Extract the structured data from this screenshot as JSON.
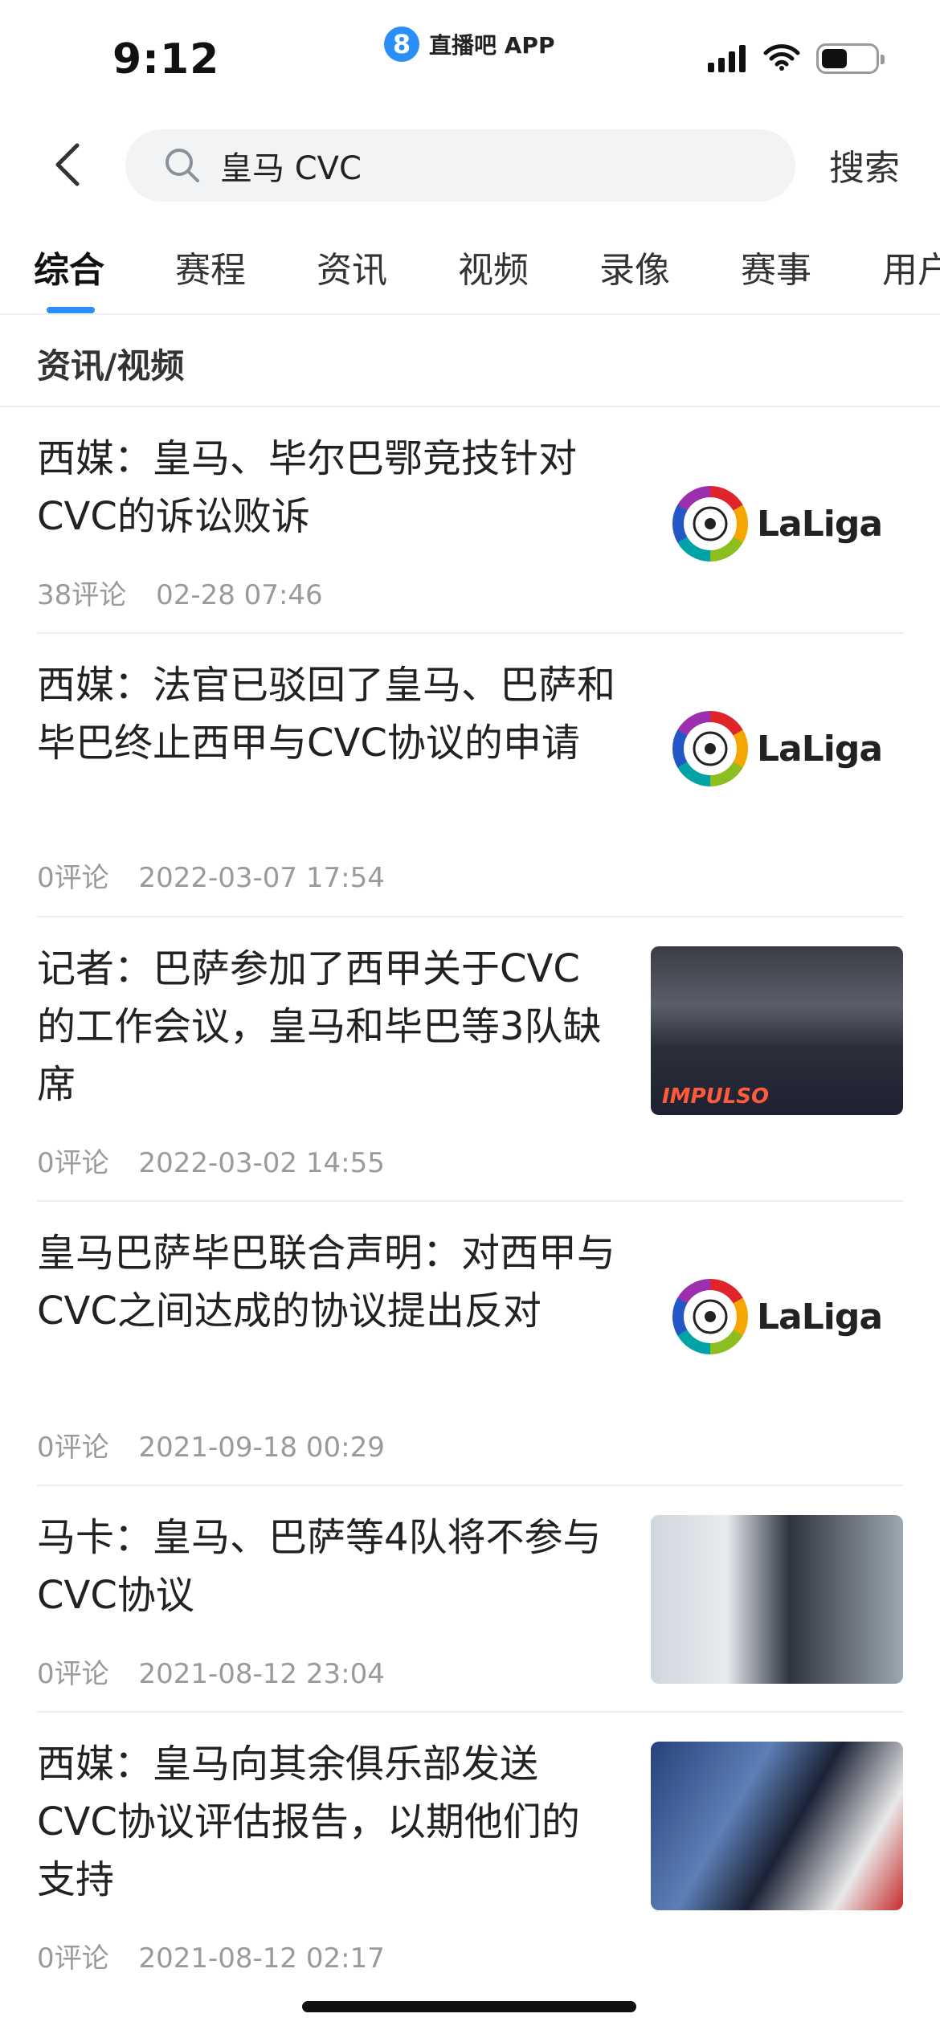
{
  "status_bar": {
    "time": "9:12",
    "app_logo_glyph": "8",
    "app_name": "直播吧 APP"
  },
  "header": {
    "search_query": "皇马 CVC",
    "search_button": "搜索"
  },
  "tabs": [
    "综合",
    "赛程",
    "资讯",
    "视频",
    "录像",
    "赛事",
    "用户"
  ],
  "active_tab": "综合",
  "section": {
    "title": "资讯/视频"
  },
  "news": [
    {
      "title": "西媒：皇马、毕尔巴鄂竞技针对CVC的诉讼败诉",
      "comments": "38评论",
      "date": "02-28 07:46",
      "thumb": "laliga-logo",
      "thumb_text": "LaLiga"
    },
    {
      "title": "西媒：法官已驳回了皇马、巴萨和毕巴终止西甲与CVC协议的申请",
      "comments": "0评论",
      "date": "2022-03-07 17:54",
      "thumb": "laliga-logo",
      "thumb_text": "LaLiga"
    },
    {
      "title": "记者：巴萨参加了西甲关于CVC的工作会议，皇马和毕巴等3队缺席",
      "comments": "0评论",
      "date": "2022-03-02 14:55",
      "thumb": "team-photo",
      "thumb_text": "IMPULSO"
    },
    {
      "title": "皇马巴萨毕巴联合声明：对西甲与CVC之间达成的协议提出反对",
      "comments": "0评论",
      "date": "2021-09-18 00:29",
      "thumb": "laliga-logo",
      "thumb_text": "LaLiga"
    },
    {
      "title": "马卡：皇马、巴萨等4队将不参与CVC协议",
      "comments": "0评论",
      "date": "2021-08-12 23:04",
      "thumb": "press-conference-photo"
    },
    {
      "title": "西媒：皇马向其余俱乐部发送CVC协议评估报告，以期他们的支持",
      "comments": "0评论",
      "date": "2021-08-12 02:17",
      "thumb": "speaker-photo"
    }
  ],
  "colors": {
    "accent": "#2a8ff7",
    "meta_text": "#9a9a9a",
    "search_bg": "#f2f3f5"
  }
}
